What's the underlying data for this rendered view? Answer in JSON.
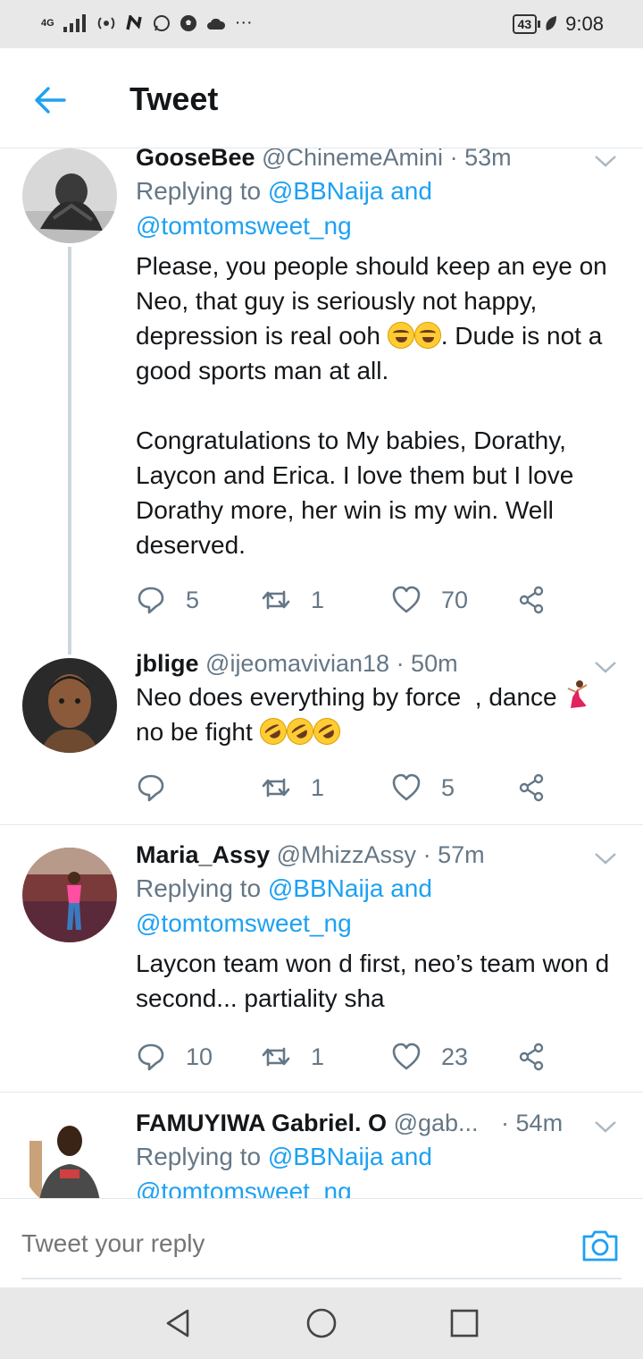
{
  "status_bar": {
    "network": "4G",
    "carrier_icons": [
      "signal-icon",
      "hotspot-icon",
      "n-icon",
      "whatsapp-icon",
      "football-icon",
      "cloud-icon"
    ],
    "more": "···",
    "battery": "43",
    "time": "9:08"
  },
  "header": {
    "title": "Tweet"
  },
  "colors": {
    "accent": "#1da1f2",
    "muted": "#657786",
    "text": "#14171a",
    "divider": "#e1e8ed"
  },
  "tweets": [
    {
      "name": "GooseBee",
      "handle": "@ChinemeAmini",
      "time": "· 53m",
      "replying_prefix": "Replying to ",
      "replying_to_1": "@BBNaija and",
      "replying_to_2": "@tomtomsweet_ng",
      "text_1": "Please, you people should keep an eye on Neo, that guy is seriously not happy, depression is real ooh ",
      "text_2": ". Dude is not a good sports man at all.",
      "text_3": "Congratulations to My babies, Dorathy, Laycon and Erica. I love them but I love Dorathy more, her win is my win. Well deserved.",
      "replies": "5",
      "retweets": "1",
      "likes": "70"
    },
    {
      "name": "jblige",
      "handle": "@ijeomavivian18",
      "time": "· 50m",
      "text_1": "Neo does everything by force  , dance ",
      "text_2": "no be fight ",
      "replies": "",
      "retweets": "1",
      "likes": "5"
    },
    {
      "name": "Maria_Assy",
      "handle": "@MhizzAssy",
      "time": "· 57m",
      "replying_prefix": "Replying to ",
      "replying_to_1": "@BBNaija and",
      "replying_to_2": "@tomtomsweet_ng",
      "text_1": "Laycon team won d first, neo’s team won d second... partiality sha",
      "replies": "10",
      "retweets": "1",
      "likes": "23"
    },
    {
      "name": "FAMUYIWA Gabriel. O",
      "handle": "@gab...",
      "time": "· 54m",
      "replying_prefix": "Replying to ",
      "replying_to_1": "@BBNaija and",
      "replying_to_2": "@tomtomsweet_ng"
    }
  ],
  "reply_bar": {
    "placeholder": "Tweet your reply"
  }
}
